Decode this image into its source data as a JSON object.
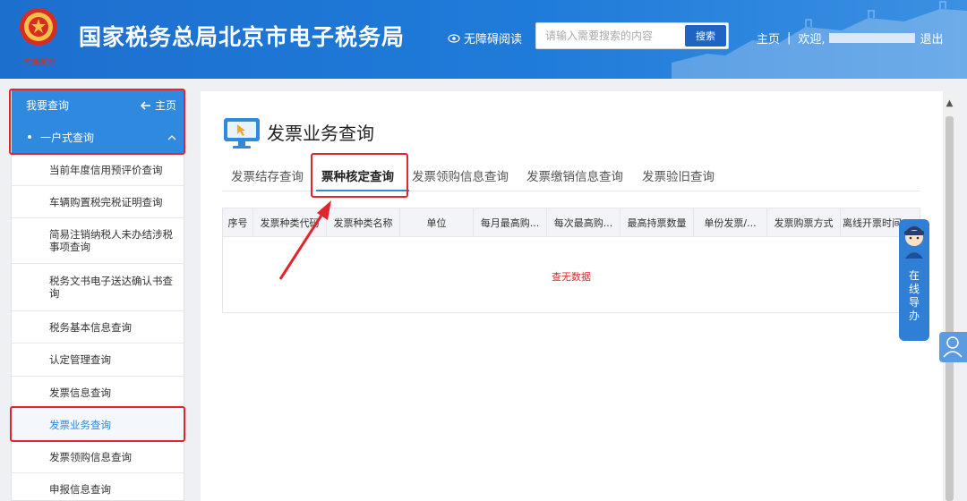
{
  "header": {
    "site_title": "国家税务总局北京市电子税务局",
    "emblem_caption": "中国税务",
    "accessibility_label": "无障碍阅读",
    "search_placeholder": "请输入需要搜索的内容",
    "search_button": "搜索",
    "home_link": "主页",
    "separator": "|",
    "welcome_text": "欢迎,",
    "logout_link": "退出"
  },
  "sidebar": {
    "header_label": "我要查询",
    "home_label": "主页",
    "group_label": "一户式查询",
    "items": [
      {
        "label": "当前年度信用预评价查询",
        "active": false
      },
      {
        "label": "车辆购置税完税证明查询",
        "active": false
      },
      {
        "label": "简易注销纳税人未办结涉税事项查询",
        "active": false
      },
      {
        "label": "税务文书电子送达确认书查询",
        "active": false
      },
      {
        "label": "税务基本信息查询",
        "active": false
      },
      {
        "label": "认定管理查询",
        "active": false
      },
      {
        "label": "发票信息查询",
        "active": false
      },
      {
        "label": "发票业务查询",
        "active": true
      },
      {
        "label": "发票领购信息查询",
        "active": false
      },
      {
        "label": "申报信息查询",
        "active": false
      }
    ]
  },
  "main": {
    "page_title": "发票业务查询",
    "tabs": [
      {
        "label": "发票结存查询",
        "active": false
      },
      {
        "label": "票种核定查询",
        "active": true
      },
      {
        "label": "发票领购信息查询",
        "active": false
      },
      {
        "label": "发票缴销信息查询",
        "active": false
      },
      {
        "label": "发票验旧查询",
        "active": false
      }
    ],
    "table": {
      "columns": [
        "序号",
        "发票种类代码",
        "发票种类名称",
        "单位",
        "每月最高购...",
        "每次最高购...",
        "最高持票数量",
        "单份发票/...",
        "发票购票方式",
        "离线开票时间"
      ],
      "empty_text": "查无数据"
    }
  },
  "helper": {
    "label": "在线导办"
  },
  "colors": {
    "header_blue": "#1f7bd9",
    "sidebar_blue": "#2f89de",
    "highlight_red": "#e0262c"
  }
}
